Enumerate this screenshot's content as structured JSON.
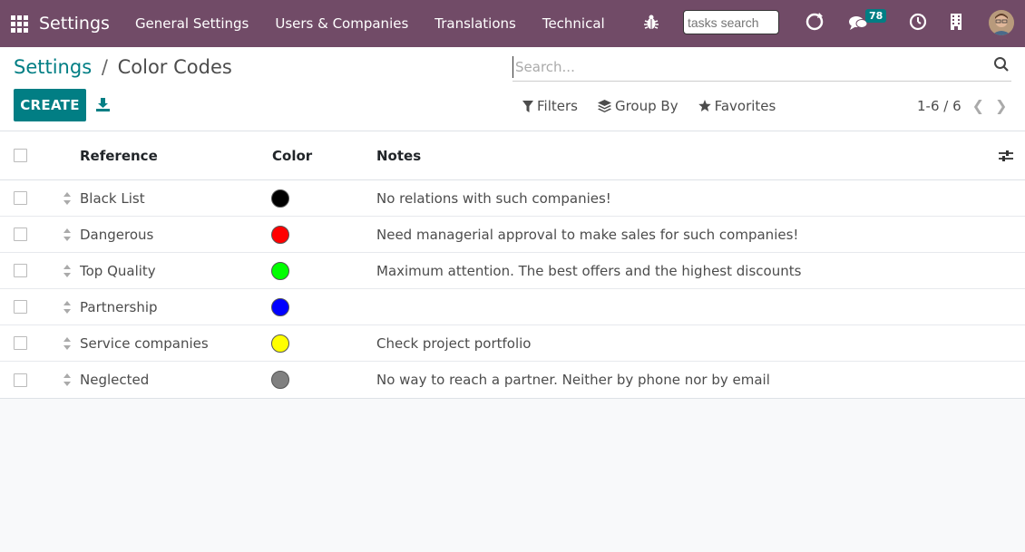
{
  "navbar": {
    "app_name": "Settings",
    "menu": [
      "General Settings",
      "Users & Companies",
      "Translations",
      "Technical"
    ],
    "tasks_search_placeholder": "tasks search",
    "chat_badge": "78",
    "bg_color": "#714b67"
  },
  "breadcrumb": {
    "parent": "Settings",
    "separator": "/",
    "current": "Color Codes"
  },
  "toolbar": {
    "create_label": "CREATE"
  },
  "search": {
    "placeholder": "Search..."
  },
  "filters": {
    "filters_label": "Filters",
    "group_by_label": "Group By",
    "favorites_label": "Favorites"
  },
  "pager": {
    "range": "1-6 / 6"
  },
  "table": {
    "headers": {
      "reference": "Reference",
      "color": "Color",
      "notes": "Notes"
    },
    "rows": [
      {
        "reference": "Black List",
        "color": "#000000",
        "notes": "No relations with such companies!"
      },
      {
        "reference": "Dangerous",
        "color": "#ff0000",
        "notes": "Need managerial approval to make sales for such companies!"
      },
      {
        "reference": "Top Quality",
        "color": "#00ff00",
        "notes": "Maximum attention. The best offers and the highest discounts"
      },
      {
        "reference": "Partnership",
        "color": "#0000ff",
        "notes": ""
      },
      {
        "reference": "Service companies",
        "color": "#ffff00",
        "notes": "Check project portfolio"
      },
      {
        "reference": "Neglected",
        "color": "#808080",
        "notes": "No way to reach a partner. Neither by phone nor by email"
      }
    ]
  },
  "colors": {
    "primary": "#017e84",
    "brand": "#714b67"
  }
}
